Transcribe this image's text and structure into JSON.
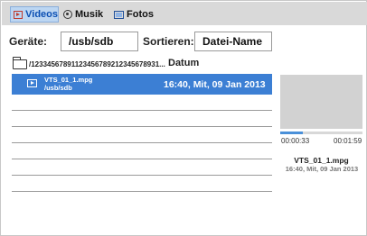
{
  "tabs": [
    {
      "label": "Videos",
      "icon": "film-icon",
      "active": true
    },
    {
      "label": "Musik",
      "icon": "disc-icon",
      "active": false
    },
    {
      "label": "Fotos",
      "icon": "photo-icon",
      "active": false
    }
  ],
  "controls": {
    "device_label": "Geräte:",
    "device_value": "/usb/sdb",
    "sort_label": "Sortieren:",
    "sort_value": "Datei-Name"
  },
  "browser": {
    "current_path": "/12334567891123456789212345678931...",
    "date_header": "Datum"
  },
  "files": [
    {
      "name": "VTS_01_1.mpg",
      "path": "/usb/sdb",
      "date": "16:40, Mit, 09 Jan 2013",
      "icon": "play-icon",
      "selected": true
    }
  ],
  "preview": {
    "time_current": "00:00:33",
    "time_total": "00:01:59",
    "progress_fraction": 0.28,
    "file_name": "VTS_01_1.mpg",
    "file_date": "16:40, Mit, 09 Jan 2013"
  },
  "colors": {
    "accent": "#3c7fd4",
    "tab_active": "#bcd6f2",
    "tabbar": "#d9d9d9",
    "preview_bg": "#d2d2d2"
  }
}
